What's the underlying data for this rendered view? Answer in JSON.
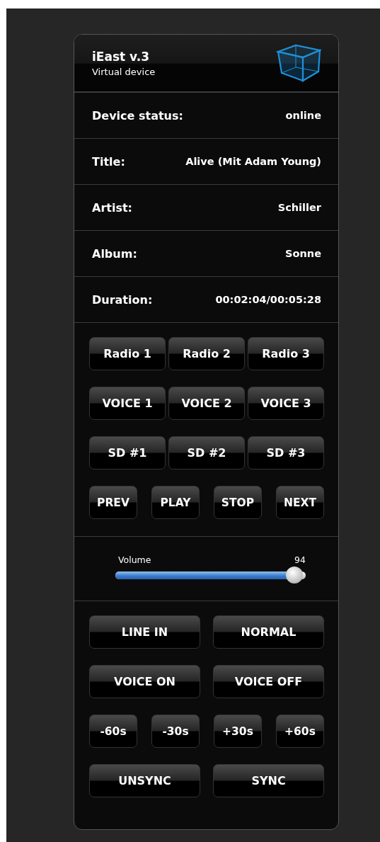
{
  "header": {
    "title": "iEast v.3",
    "subtitle": "Virtual device"
  },
  "info_rows": [
    {
      "label": "Device status:",
      "value": "online"
    },
    {
      "label": "Title:",
      "value": "Alive (Mit Adam Young)"
    },
    {
      "label": "Artist:",
      "value": "Schiller"
    },
    {
      "label": "Album:",
      "value": "Sonne"
    },
    {
      "label": "Duration:",
      "value": "00:02:04/00:05:28"
    }
  ],
  "source_buttons": [
    [
      "Radio 1",
      "Radio 2",
      "Radio 3"
    ],
    [
      "VOICE 1",
      "VOICE 2",
      "VOICE 3"
    ],
    [
      "SD #1",
      "SD #2",
      "SD #3"
    ],
    [
      "PREV",
      "PLAY",
      "STOP",
      "NEXT"
    ]
  ],
  "volume": {
    "label": "Volume",
    "reading": "94",
    "level": 0.94
  },
  "mode_buttons": [
    [
      "LINE IN",
      "NORMAL"
    ],
    [
      "VOICE ON",
      "VOICE OFF"
    ],
    [
      "-60s",
      "-30s",
      "+30s",
      "+60s"
    ],
    [
      "UNSYNC",
      "SYNC"
    ]
  ]
}
